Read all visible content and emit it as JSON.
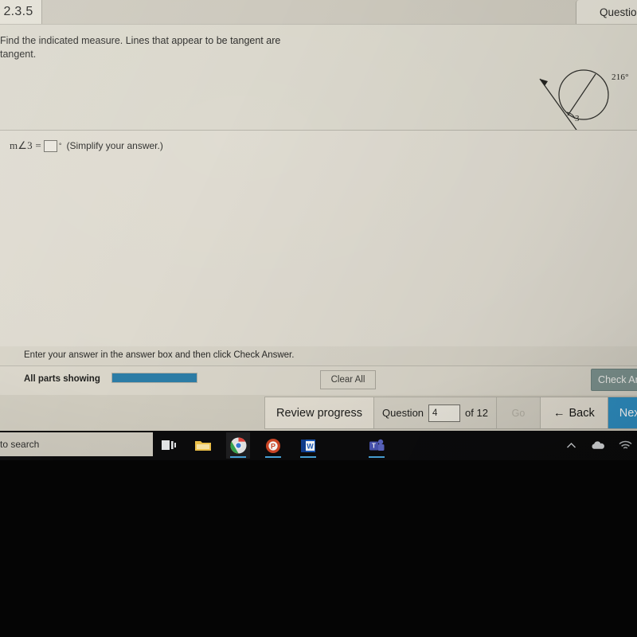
{
  "window": {
    "exercise_id": "2.3.5",
    "question_tab_label": "Question"
  },
  "problem": {
    "statement": "Find the indicated measure. Lines that appear to be tangent are tangent.",
    "figure": {
      "arc_measure_label": "216°",
      "angle_label": "3"
    }
  },
  "answer": {
    "prompt_prefix": "m∠3 =",
    "input_value": "",
    "input_placeholder": "",
    "degree_symbol": "°",
    "hint": "(Simplify your answer.)"
  },
  "footer": {
    "instruction": "Enter your answer in the answer box and then click Check Answer.",
    "parts_status": "All parts showing",
    "progress_percent": 100,
    "clear_all_label": "Clear All",
    "check_answer_label": "Check Answer"
  },
  "navigation": {
    "review_progress_label": "Review progress",
    "question_word": "Question",
    "question_number": "4",
    "of_label": "of 12",
    "go_label": "Go",
    "back_label": "Back",
    "next_label": "Next",
    "back_arrow": "←"
  },
  "taskbar": {
    "search_text": "to search",
    "apps": [
      {
        "name": "file-explorer",
        "label": "File Explorer"
      },
      {
        "name": "google-chrome",
        "label": "Google Chrome"
      },
      {
        "name": "powerpoint",
        "label": "PowerPoint",
        "glyph": "P"
      },
      {
        "name": "word",
        "label": "Word",
        "glyph": "W"
      },
      {
        "name": "microsoft-teams",
        "label": "Microsoft Teams",
        "glyph": "T"
      }
    ],
    "tray": [
      {
        "name": "show-hidden-icons",
        "glyph": "^"
      },
      {
        "name": "onedrive",
        "glyph": "☁"
      },
      {
        "name": "wifi",
        "glyph": "◠"
      }
    ]
  },
  "colors": {
    "accent_blue": "#2f90c4",
    "progress_blue": "#2b7ca6",
    "check_button": "#7d938f",
    "screen_bg": "#d6d2c6"
  }
}
